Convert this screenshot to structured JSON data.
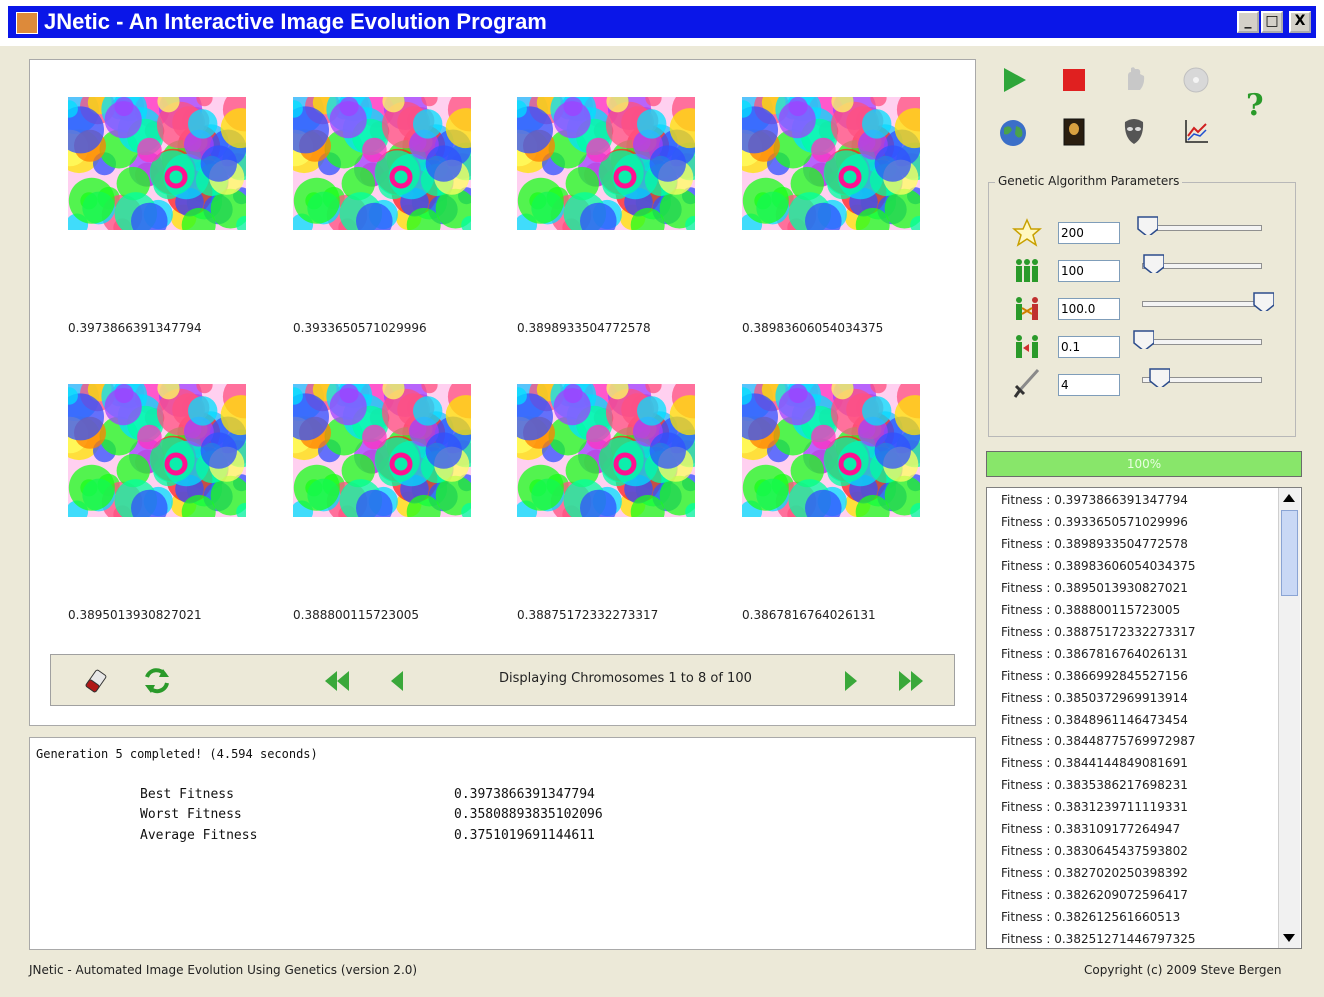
{
  "window": {
    "title": "JNetic - An Interactive Image Evolution Program",
    "minimize_glyph": "_",
    "maximize_glyph": "□",
    "close_glyph": "X"
  },
  "gallery": {
    "fitness_labels": [
      "0.3973866391347794",
      "0.3933650571029996",
      "0.3898933504772578",
      "0.38983606054034375",
      "0.3895013930827021",
      "0.388800115723005",
      "0.38875172332273317",
      "0.3867816764026131"
    ]
  },
  "nav": {
    "display_text": "Displaying Chromosomes 1 to 8 of 100"
  },
  "stats": {
    "message": "Generation 5 completed! (4.594 seconds)",
    "best_label": "Best Fitness",
    "best_value": "0.3973866391347794",
    "worst_label": "Worst Fitness",
    "worst_value": "0.35808893835102096",
    "average_label": "Average Fitness",
    "average_value": "0.3751019691144611"
  },
  "toolbar": {
    "help_glyph": "?"
  },
  "ga_params": {
    "legend": "Genetic Algorithm Parameters",
    "generations": "200",
    "population": "100",
    "crossover": "100.0",
    "mutation": "0.1",
    "elitism": "4",
    "slider_levels": [
      0.05,
      0.1,
      1.0,
      0.02,
      0.15
    ]
  },
  "progress": {
    "label": "100%",
    "value": 1.0
  },
  "fitness_list": [
    "Fitness : 0.3973866391347794",
    "Fitness : 0.3933650571029996",
    "Fitness : 0.3898933504772578",
    "Fitness : 0.38983606054034375",
    "Fitness : 0.3895013930827021",
    "Fitness : 0.388800115723005",
    "Fitness : 0.38875172332273317",
    "Fitness : 0.3867816764026131",
    "Fitness : 0.3866992845527156",
    "Fitness : 0.3850372969913914",
    "Fitness : 0.3848961146473454",
    "Fitness : 0.38448775769972987",
    "Fitness : 0.3844144849081691",
    "Fitness : 0.3835386217698231",
    "Fitness : 0.3831239711119331",
    "Fitness : 0.383109177264947",
    "Fitness : 0.3830645437593802",
    "Fitness : 0.3827020250398392",
    "Fitness : 0.3826209072596417",
    "Fitness : 0.382612561660513",
    "Fitness : 0.38251271446797325"
  ],
  "footer": {
    "left": "JNetic - Automated Image Evolution Using Genetics (version 2.0)",
    "right": "Copyright (c) 2009 Steve Bergen"
  }
}
